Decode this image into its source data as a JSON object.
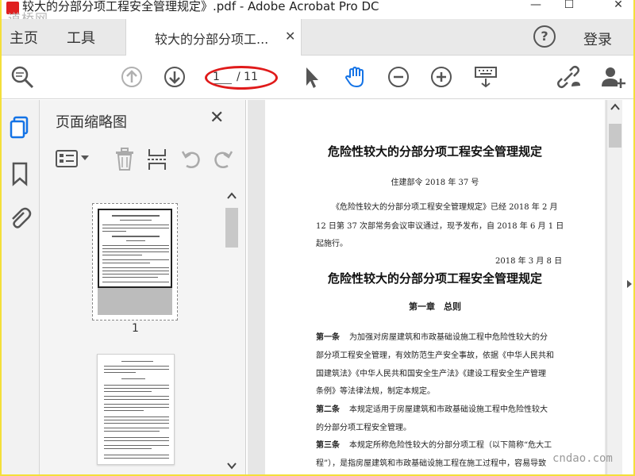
{
  "titlebar": {
    "title": "较大的分部分项工程安全管理规定》.pdf - Adobe Acrobat Pro DC",
    "watermark": "道桥网",
    "min_glyph": "—",
    "max_glyph": "☐",
    "close_glyph": "✕"
  },
  "menu": {
    "home": "主页",
    "tools": "工具",
    "doc_tab": "较大的分部分项工...",
    "tab_close": "✕",
    "help": "?",
    "login": "登录"
  },
  "toolbar": {
    "page_current": "1",
    "page_total": "/ 11",
    "icons": [
      "find-icon",
      "prev-page-icon",
      "next-page-icon",
      "select-arrow-icon",
      "hand-icon",
      "zoom-out-icon",
      "zoom-in-icon",
      "keyboard-icon",
      "share-link-icon",
      "add-user-icon"
    ]
  },
  "thumbnails": {
    "title": "页面缩略图",
    "close": "✕",
    "page1_number": "1"
  },
  "document": {
    "title": "危险性较大的分部分项工程安全管理规定",
    "order": "住建部令 2018 年 37 号",
    "para1_l1": "《危险性较大的分部分项工程安全管理规定》已经 2018 年 2 月",
    "para1_l2": "12 日第 37 次部常务会议审议通过，现予发布，自 2018 年 6 月 1 日",
    "para1_l3": "起施行。",
    "date": "2018 年 3 月 8 日",
    "title2": "危险性较大的分部分项工程安全管理规定",
    "chapter1": "第一章　总则",
    "art1_label": "第一条",
    "art1_l1": "为加强对房屋建筑和市政基础设施工程中危险性较大的分",
    "art1_l2": "部分项工程安全管理，有效防范生产安全事故，依据《中华人民共和",
    "art1_l3": "国建筑法》《中华人民共和国安全生产法》《建设工程安全生产管理",
    "art1_l4": "条例》等法律法规，制定本规定。",
    "art2_label": "第二条",
    "art2_l1": "本规定适用于房屋建筑和市政基础设施工程中危险性较大",
    "art2_l2": "的分部分项工程安全管理。",
    "art3_label": "第三条",
    "art3_l1": "本规定所称危险性较大的分部分项工程（以下简称“危大工",
    "art3_l2": "程”），是指房屋建筑和市政基础设施工程在施工过程中，容易导致"
  },
  "watermark_br": "cndao.com",
  "colors": {
    "accent_blue": "#1473e6",
    "oval_red": "#e01a1a",
    "outer_frame": "#f4df3a"
  }
}
